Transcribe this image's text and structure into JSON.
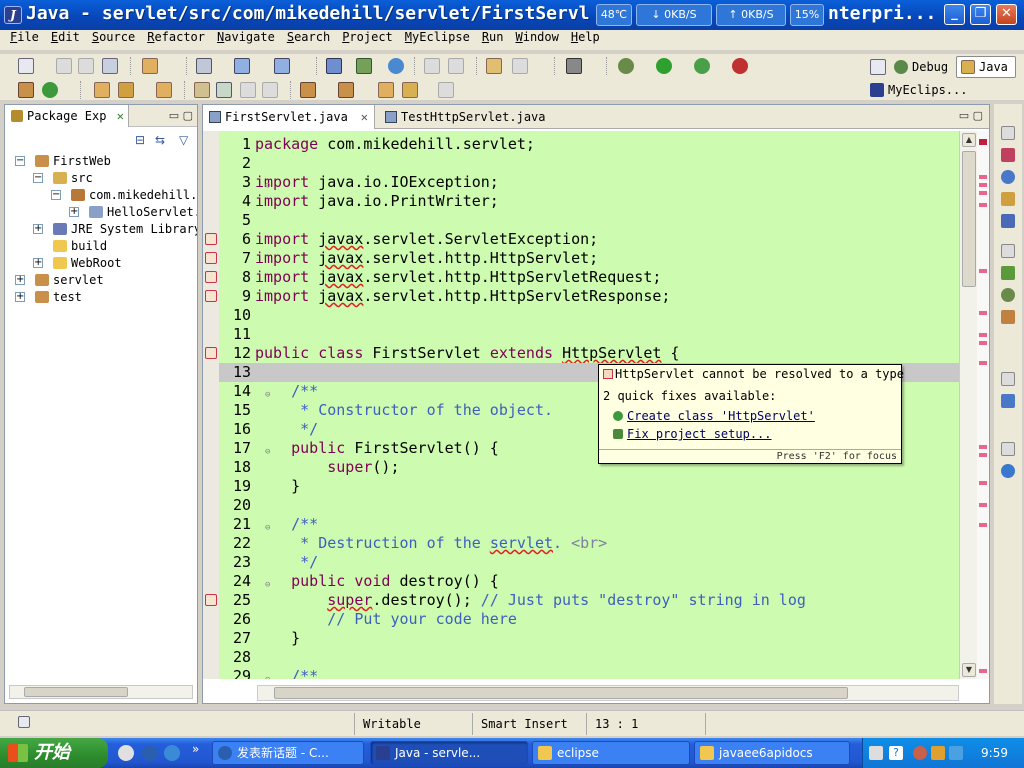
{
  "window": {
    "title": "Java - servlet/src/com/mikedehill/servlet/FirstServl",
    "title_tail": "nterpri...",
    "netmeter": {
      "temp": "48℃",
      "down": "0KB/S",
      "up": "0KB/S",
      "cpu": "15%"
    }
  },
  "menu": [
    "File",
    "Edit",
    "Source",
    "Refactor",
    "Navigate",
    "Search",
    "Project",
    "MyEclipse",
    "Run",
    "Window",
    "Help"
  ],
  "perspectives": {
    "debug": "Debug",
    "java": "Java",
    "myeclipse": "MyEclips..."
  },
  "package_explorer": {
    "tab_label": "Package Exp",
    "tree": [
      {
        "label": "FirstWeb",
        "depth": 0,
        "icon": "project-icon",
        "expander": "−"
      },
      {
        "label": "src",
        "depth": 1,
        "icon": "source-folder-icon",
        "expander": "−"
      },
      {
        "label": "com.mikedehill.:",
        "depth": 2,
        "icon": "package-icon",
        "expander": "−"
      },
      {
        "label": "HelloServlet.",
        "depth": 3,
        "icon": "java-file-icon",
        "expander": "+"
      },
      {
        "label": "JRE System Library",
        "depth": 1,
        "icon": "library-icon",
        "expander": "+"
      },
      {
        "label": "build",
        "depth": 1,
        "icon": "folder-icon",
        "expander": ""
      },
      {
        "label": "WebRoot",
        "depth": 1,
        "icon": "folder-icon",
        "expander": "+"
      },
      {
        "label": "servlet",
        "depth": 0,
        "icon": "project-icon",
        "expander": "+"
      },
      {
        "label": "test",
        "depth": 0,
        "icon": "project-icon",
        "expander": "+"
      }
    ]
  },
  "editor": {
    "tabs": [
      {
        "label": "FirstServlet.java",
        "active": true
      },
      {
        "label": "TestHttpServlet.java",
        "active": false
      }
    ],
    "lines": [
      {
        "n": "1",
        "html": "<span class=\"kw\">package</span> com.mikedehill.servlet;"
      },
      {
        "n": "2",
        "html": ""
      },
      {
        "n": "3",
        "html": "<span class=\"kw\">import</span> java.io.IOException;"
      },
      {
        "n": "4",
        "html": "<span class=\"kw\">import</span> java.io.PrintWriter;"
      },
      {
        "n": "5",
        "html": ""
      },
      {
        "n": "6",
        "html": "<span class=\"kw\">import</span> <span class=\"err\">javax</span>.servlet.ServletException;"
      },
      {
        "n": "7",
        "html": "<span class=\"kw\">import</span> <span class=\"err\">javax</span>.servlet.http.HttpServlet;"
      },
      {
        "n": "8",
        "html": "<span class=\"kw\">import</span> <span class=\"err\">javax</span>.servlet.http.HttpServletRequest;"
      },
      {
        "n": "9",
        "html": "<span class=\"kw\">import</span> <span class=\"err\">javax</span>.servlet.http.HttpServletResponse;"
      },
      {
        "n": "10",
        "html": ""
      },
      {
        "n": "11",
        "html": ""
      },
      {
        "n": "12",
        "html": "<span class=\"kw\">public class</span> FirstServlet <span class=\"kw\">extends</span> <span class=\"err\">HttpServlet</span> {"
      },
      {
        "n": "13",
        "html": ""
      },
      {
        "n": "14",
        "html": "    <span class=\"cm\">/**</span>"
      },
      {
        "n": "15",
        "html": "<span class=\"cm\">     * Constructor of the object.</span>"
      },
      {
        "n": "16",
        "html": "<span class=\"cm\">     */</span>"
      },
      {
        "n": "17",
        "html": "    <span class=\"kw\">public</span> FirstServlet() {"
      },
      {
        "n": "18",
        "html": "        <span class=\"kw\">super</span>();"
      },
      {
        "n": "19",
        "html": "    }"
      },
      {
        "n": "20",
        "html": ""
      },
      {
        "n": "21",
        "html": "    <span class=\"cm\">/**</span>"
      },
      {
        "n": "22",
        "html": "<span class=\"cm\">     * Destruction of the <span class=\"err\">servlet</span>. </span><span class=\"tag\">&lt;br&gt;</span>"
      },
      {
        "n": "23",
        "html": "<span class=\"cm\">     */</span>"
      },
      {
        "n": "24",
        "html": "    <span class=\"kw\">public void</span> destroy() {"
      },
      {
        "n": "25",
        "html": "        <span class=\"kw err\">super</span>.destroy(); <span class=\"cm\">// Just puts \"destroy\" string in log</span>"
      },
      {
        "n": "26",
        "html": "        <span class=\"cm\">// Put your code here</span>"
      },
      {
        "n": "27",
        "html": "    }"
      },
      {
        "n": "28",
        "html": ""
      },
      {
        "n": "29",
        "html": "    <span class=\"cm\">/**</span>"
      }
    ],
    "current_line": "13"
  },
  "quickfix": {
    "message": "HttpServlet cannot be resolved to a type",
    "count_label": "2 quick fixes available:",
    "fixes": [
      "Create class 'HttpServlet'",
      "Fix project setup..."
    ],
    "footer": "Press 'F2' for focus"
  },
  "status": {
    "writable": "Writable",
    "insert_mode": "Smart Insert",
    "position": "13 : 1"
  },
  "taskbar": {
    "start_label": "开始",
    "tasks": [
      "发表新话题 - C...",
      "Java - servle...",
      "eclipse",
      "javaee6apidocs"
    ],
    "clock": "9:59"
  },
  "colors": {
    "editor_bg": "#cdfbaf",
    "keyword": "#7f0055",
    "comment": "#3f5fbf",
    "error": "#e02020",
    "titlebar": "#0a5fd8"
  }
}
